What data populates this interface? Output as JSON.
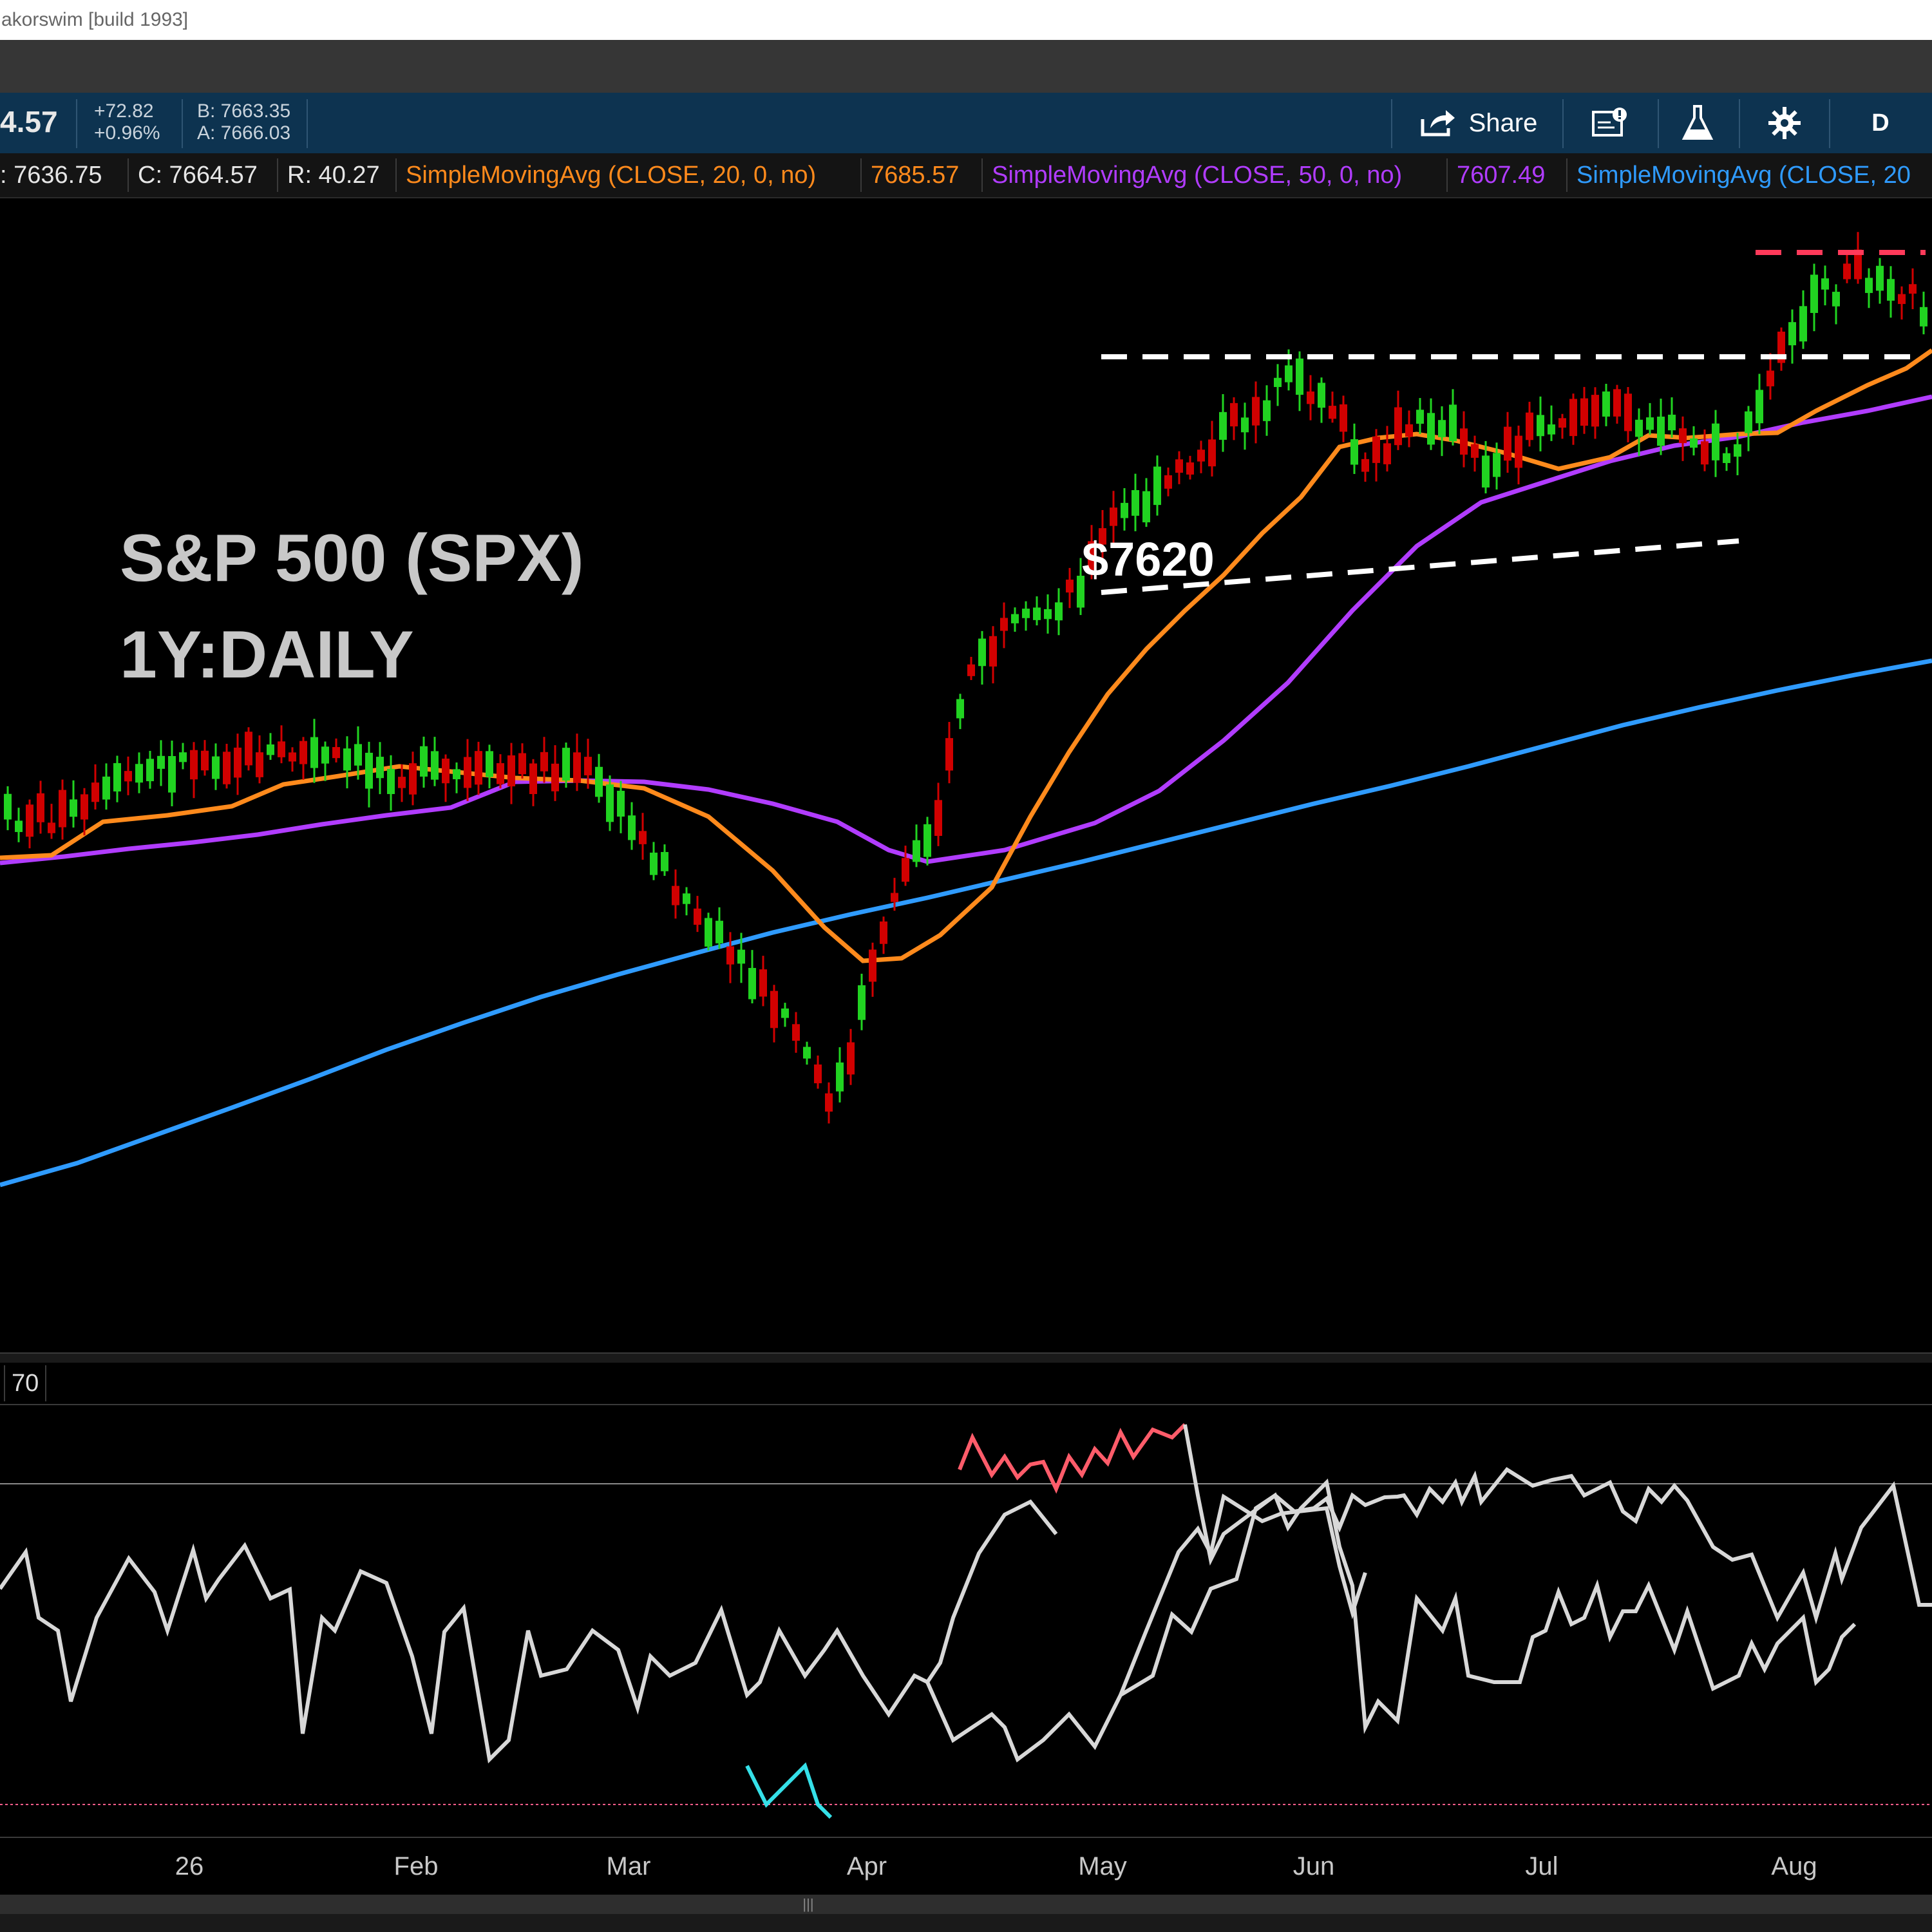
{
  "window": {
    "title": "akorswim [build 1993]"
  },
  "quote": {
    "last": "4.57",
    "change": "+72.82",
    "change_pct": "+0.96%",
    "bid": "B: 7663.35",
    "ask": "A: 7666.03"
  },
  "toolbar": {
    "share_label": "Share",
    "timeframe_label": "D"
  },
  "studies": {
    "low": ": 7636.75",
    "close": "C: 7664.57",
    "range": "R: 40.27",
    "sma20_label": "SimpleMovingAvg (CLOSE, 20, 0, no)",
    "sma20_value": "7685.57",
    "sma50_label": "SimpleMovingAvg (CLOSE, 50, 0, no)",
    "sma50_value": "7607.49",
    "sma200_label": "SimpleMovingAvg (CLOSE, 20",
    "colors": {
      "sma20": "#ff8a1c",
      "sma50": "#b13cff",
      "sma200": "#2f9bff",
      "up": "#21d321",
      "down": "#d10000"
    }
  },
  "chart": {
    "title_line1": "S&P 500 (SPX)",
    "title_line2": "1Y:DAILY",
    "resistance_label": "$7620"
  },
  "rsi": {
    "level_label": "70"
  },
  "xaxis": {
    "labels": [
      "26",
      "Feb",
      "Mar",
      "Apr",
      "May",
      "Jun",
      "Jul",
      "Aug"
    ]
  },
  "chart_data": {
    "type": "line",
    "title": "S&P 500 (SPX)",
    "subtitle": "1Y:DAILY",
    "categories": [
      "26",
      "Feb",
      "Mar",
      "Apr",
      "May",
      "Jun",
      "Jul",
      "Aug"
    ],
    "annotations": [
      "$7620"
    ],
    "series": [
      {
        "name": "SimpleMovingAvg (CLOSE, 20, 0, no)",
        "last": 7685.57,
        "values": [
          6950,
          7010,
          6990,
          6700,
          7250,
          7560,
          7545,
          7700
        ]
      },
      {
        "name": "SimpleMovingAvg (CLOSE, 50, 0, no)",
        "last": 7607.49,
        "values": [
          6960,
          7010,
          6985,
          6850,
          7000,
          7420,
          7540,
          7650
        ]
      },
      {
        "name": "SimpleMovingAvg (CLOSE, 20",
        "values": [
          6580,
          6650,
          6730,
          6810,
          6880,
          6950,
          7020,
          7080
        ]
      },
      {
        "name": "RSI",
        "values": [
          60,
          52,
          44,
          22,
          72,
          72,
          58,
          66
        ]
      }
    ],
    "last_close": 7664.57,
    "bid": 7663.35,
    "ask": 7666.03,
    "change": 72.82,
    "change_pct": 0.96,
    "resistance": 7620,
    "rsi_overbought": 70
  }
}
